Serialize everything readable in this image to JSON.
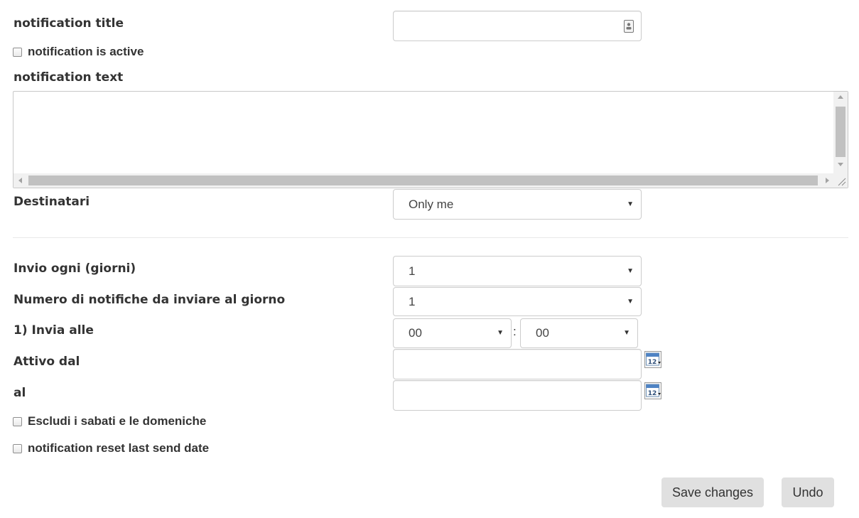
{
  "form": {
    "title_label": "notification title",
    "title_value": "",
    "active_label": "notification is active",
    "text_label": "notification text",
    "text_value": "",
    "recipients_label": "Destinatari",
    "recipients_value": "Only me",
    "interval_label": "Invio ogni (giorni)",
    "interval_value": "1",
    "count_label": "Numero di notifiche da inviare al giorno",
    "count_value": "1",
    "send_at_label": "1) Invia alle",
    "send_hour": "00",
    "time_separator": ":",
    "send_minute": "00",
    "active_from_label": "Attivo dal",
    "active_from_value": "",
    "active_to_label": "al",
    "active_to_value": "",
    "exclude_weekend_label": "Escludi i sabati e le domeniche",
    "reset_label": "notification reset last send date"
  },
  "icons": {
    "calendar_day": "12"
  },
  "actions": {
    "save_label": "Save changes",
    "undo_label": "Undo"
  },
  "colors": {
    "button_bg": "#e0e0e0",
    "border": "#cccccc",
    "text": "#333333"
  }
}
